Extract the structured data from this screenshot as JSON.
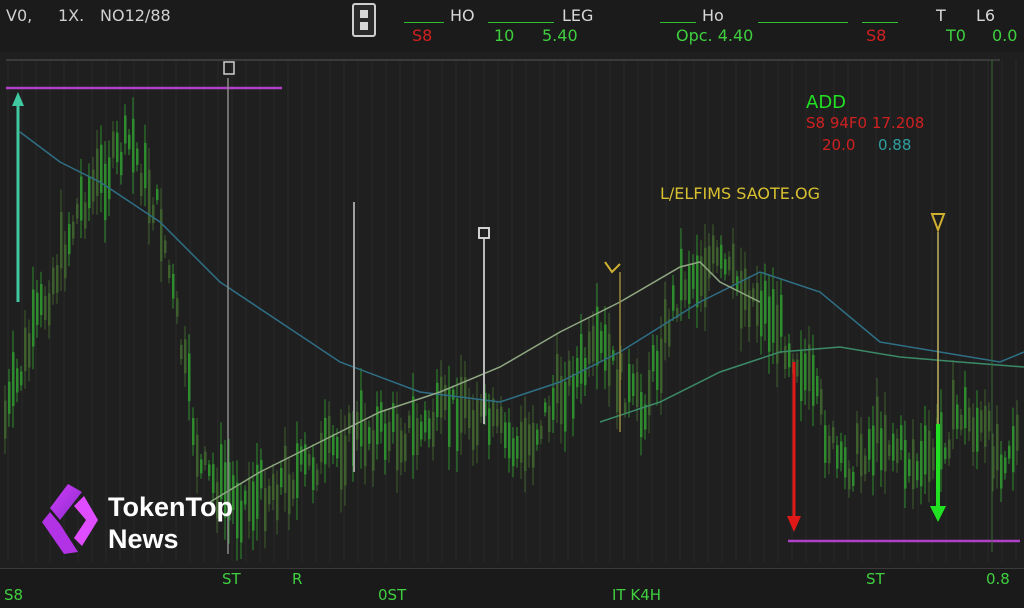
{
  "header": {
    "symbol_prefix": "V0,",
    "symbol_mid": "1X.",
    "symbol_name": "NO12/88",
    "field_1_label": "HO",
    "field_2_label": "LEG",
    "field_1_value_a": "S8",
    "field_1_value_b": "10",
    "field_2_value": "5.40",
    "field_3_label": "Ho",
    "field_3_value": "Opc. 4.40",
    "field_4_label": "T",
    "field_5_label": "L6",
    "field_4_value": "S8",
    "field_5_value_a": "T0",
    "field_5_value_b": "0.0"
  },
  "chart": {
    "annotation_add": "ADD",
    "annotation_line_1": "S8 94F0 17.208",
    "annotation_line_2a": "20.0",
    "annotation_line_2b": "0.88",
    "annotation_center": "L/ELFIMS SAOTE.OG",
    "colors": {
      "background": "#1f1f1f",
      "up_candle": "#2e8b2e",
      "down_candle": "#3d5f2d",
      "moving_average_1": "#8fa882",
      "moving_average_2": "#2f6f85",
      "buy_arrow": "#22e022",
      "sell_arrow": "#e01818",
      "level_line": "#b040c8",
      "entry_arrow": "#40c8a0"
    }
  },
  "watermark": {
    "line_1": "TokenTop",
    "line_2": "News"
  },
  "footer": {
    "left": "S8",
    "tick_1": "ST",
    "tick_2": "R",
    "tick_3": "0ST",
    "tick_4": "IT K4H",
    "tick_5": "ST",
    "right": "0.8"
  }
}
